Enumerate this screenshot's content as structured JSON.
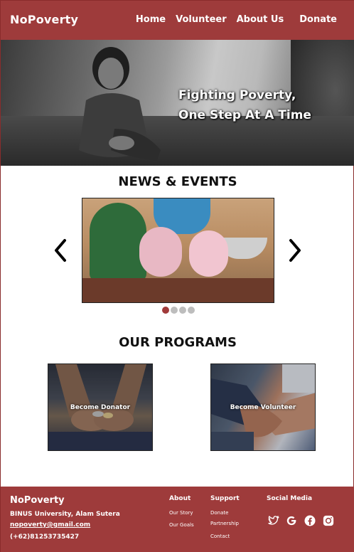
{
  "navbar": {
    "brand": "NoPoverty",
    "links": [
      "Home",
      "Volunteer",
      "About Us",
      "Donate"
    ]
  },
  "hero": {
    "line1": "Fighting Poverty,",
    "line2": "One Step At A Time"
  },
  "news": {
    "title": "NEWS & EVENTS",
    "slide_count": 4,
    "active_slide": 1
  },
  "programs": {
    "title": "OUR PROGRAMS",
    "items": [
      {
        "label": "Become Donator"
      },
      {
        "label": "Become Volunteer"
      }
    ]
  },
  "footer": {
    "brand": "NoPoverty",
    "address": "BINUS University, Alam Sutera",
    "email": "nopoverty@gmail.com",
    "phone": "(+62)81253735427",
    "about": {
      "title": "About",
      "links": [
        "Our Story",
        "Our Goals"
      ]
    },
    "support": {
      "title": "Support",
      "links": [
        "Donate",
        "Partnership",
        "Contact"
      ]
    },
    "social": {
      "title": "Social Media",
      "icons": [
        "twitter-icon",
        "google-icon",
        "facebook-icon",
        "instagram-icon"
      ]
    }
  },
  "colors": {
    "brand": "#9e3b3b",
    "active_dot": "#a13a3a",
    "inactive_dot": "#bdbdbd"
  }
}
